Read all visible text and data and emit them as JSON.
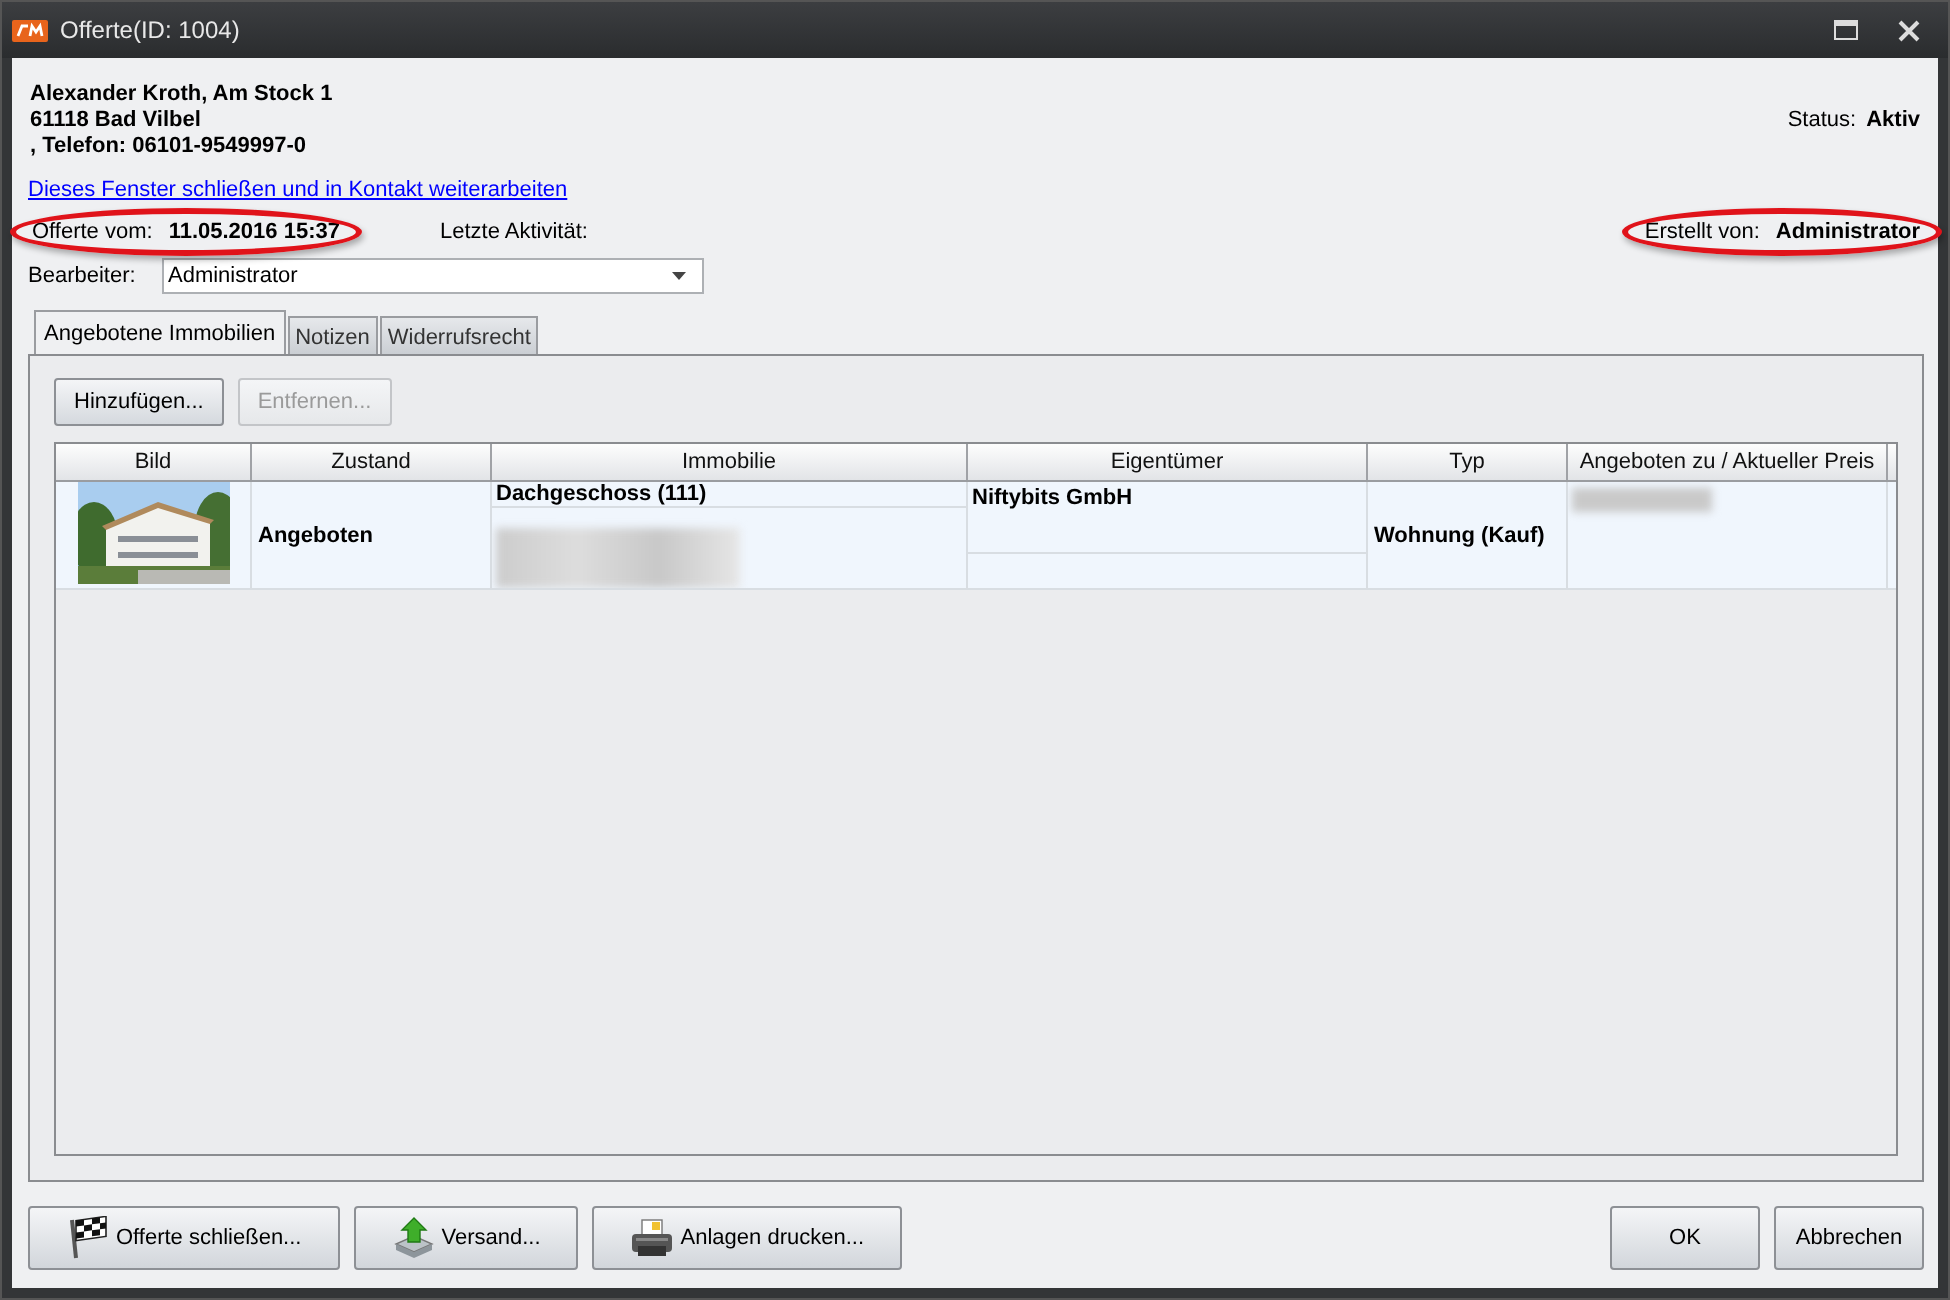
{
  "window": {
    "title": "Offerte(ID: 1004)"
  },
  "contact": {
    "lines": [
      "Alexander Kroth, Am Stock 1",
      "61118 Bad Vilbel",
      ", Telefon: 06101-9549997-0"
    ],
    "status_label": "Status:",
    "status_value": "Aktiv"
  },
  "link": "Dieses Fenster schließen und in Kontakt weiterarbeiten",
  "info": {
    "offer_label": "Offerte vom:",
    "offer_value": "11.05.2016 15:37",
    "last_activity_label": "Letzte Aktivität:",
    "created_label": "Erstellt von:",
    "created_value": "Administrator"
  },
  "editor": {
    "label": "Bearbeiter:",
    "value": "Administrator"
  },
  "tabs": [
    {
      "label": "Angebotene Immobilien",
      "selected": true
    },
    {
      "label": "Notizen",
      "selected": false
    },
    {
      "label": "Widerrufsrecht",
      "selected": false
    }
  ],
  "toolbar": [
    {
      "label": "Hinzufügen...",
      "disabled": false
    },
    {
      "label": "Entfernen...",
      "disabled": true
    }
  ],
  "table": {
    "columns": [
      "Bild",
      "Zustand",
      "Immobilie",
      "Eigentümer",
      "Typ",
      "Angeboten zu / Aktueller Preis"
    ],
    "rows": [
      {
        "zustand": "Angeboten",
        "immobilie": "Dachgeschoss (111)",
        "eigentuemer": "Niftybits GmbH",
        "typ": "Wohnung (Kauf)"
      }
    ]
  },
  "footer_left": [
    {
      "label": "Offerte schließen...",
      "kind": "flag"
    },
    {
      "label": "Versand...",
      "kind": "send"
    },
    {
      "label": "Anlagen drucken...",
      "kind": "printer"
    }
  ],
  "footer_right": [
    "OK",
    "Abbrechen"
  ]
}
